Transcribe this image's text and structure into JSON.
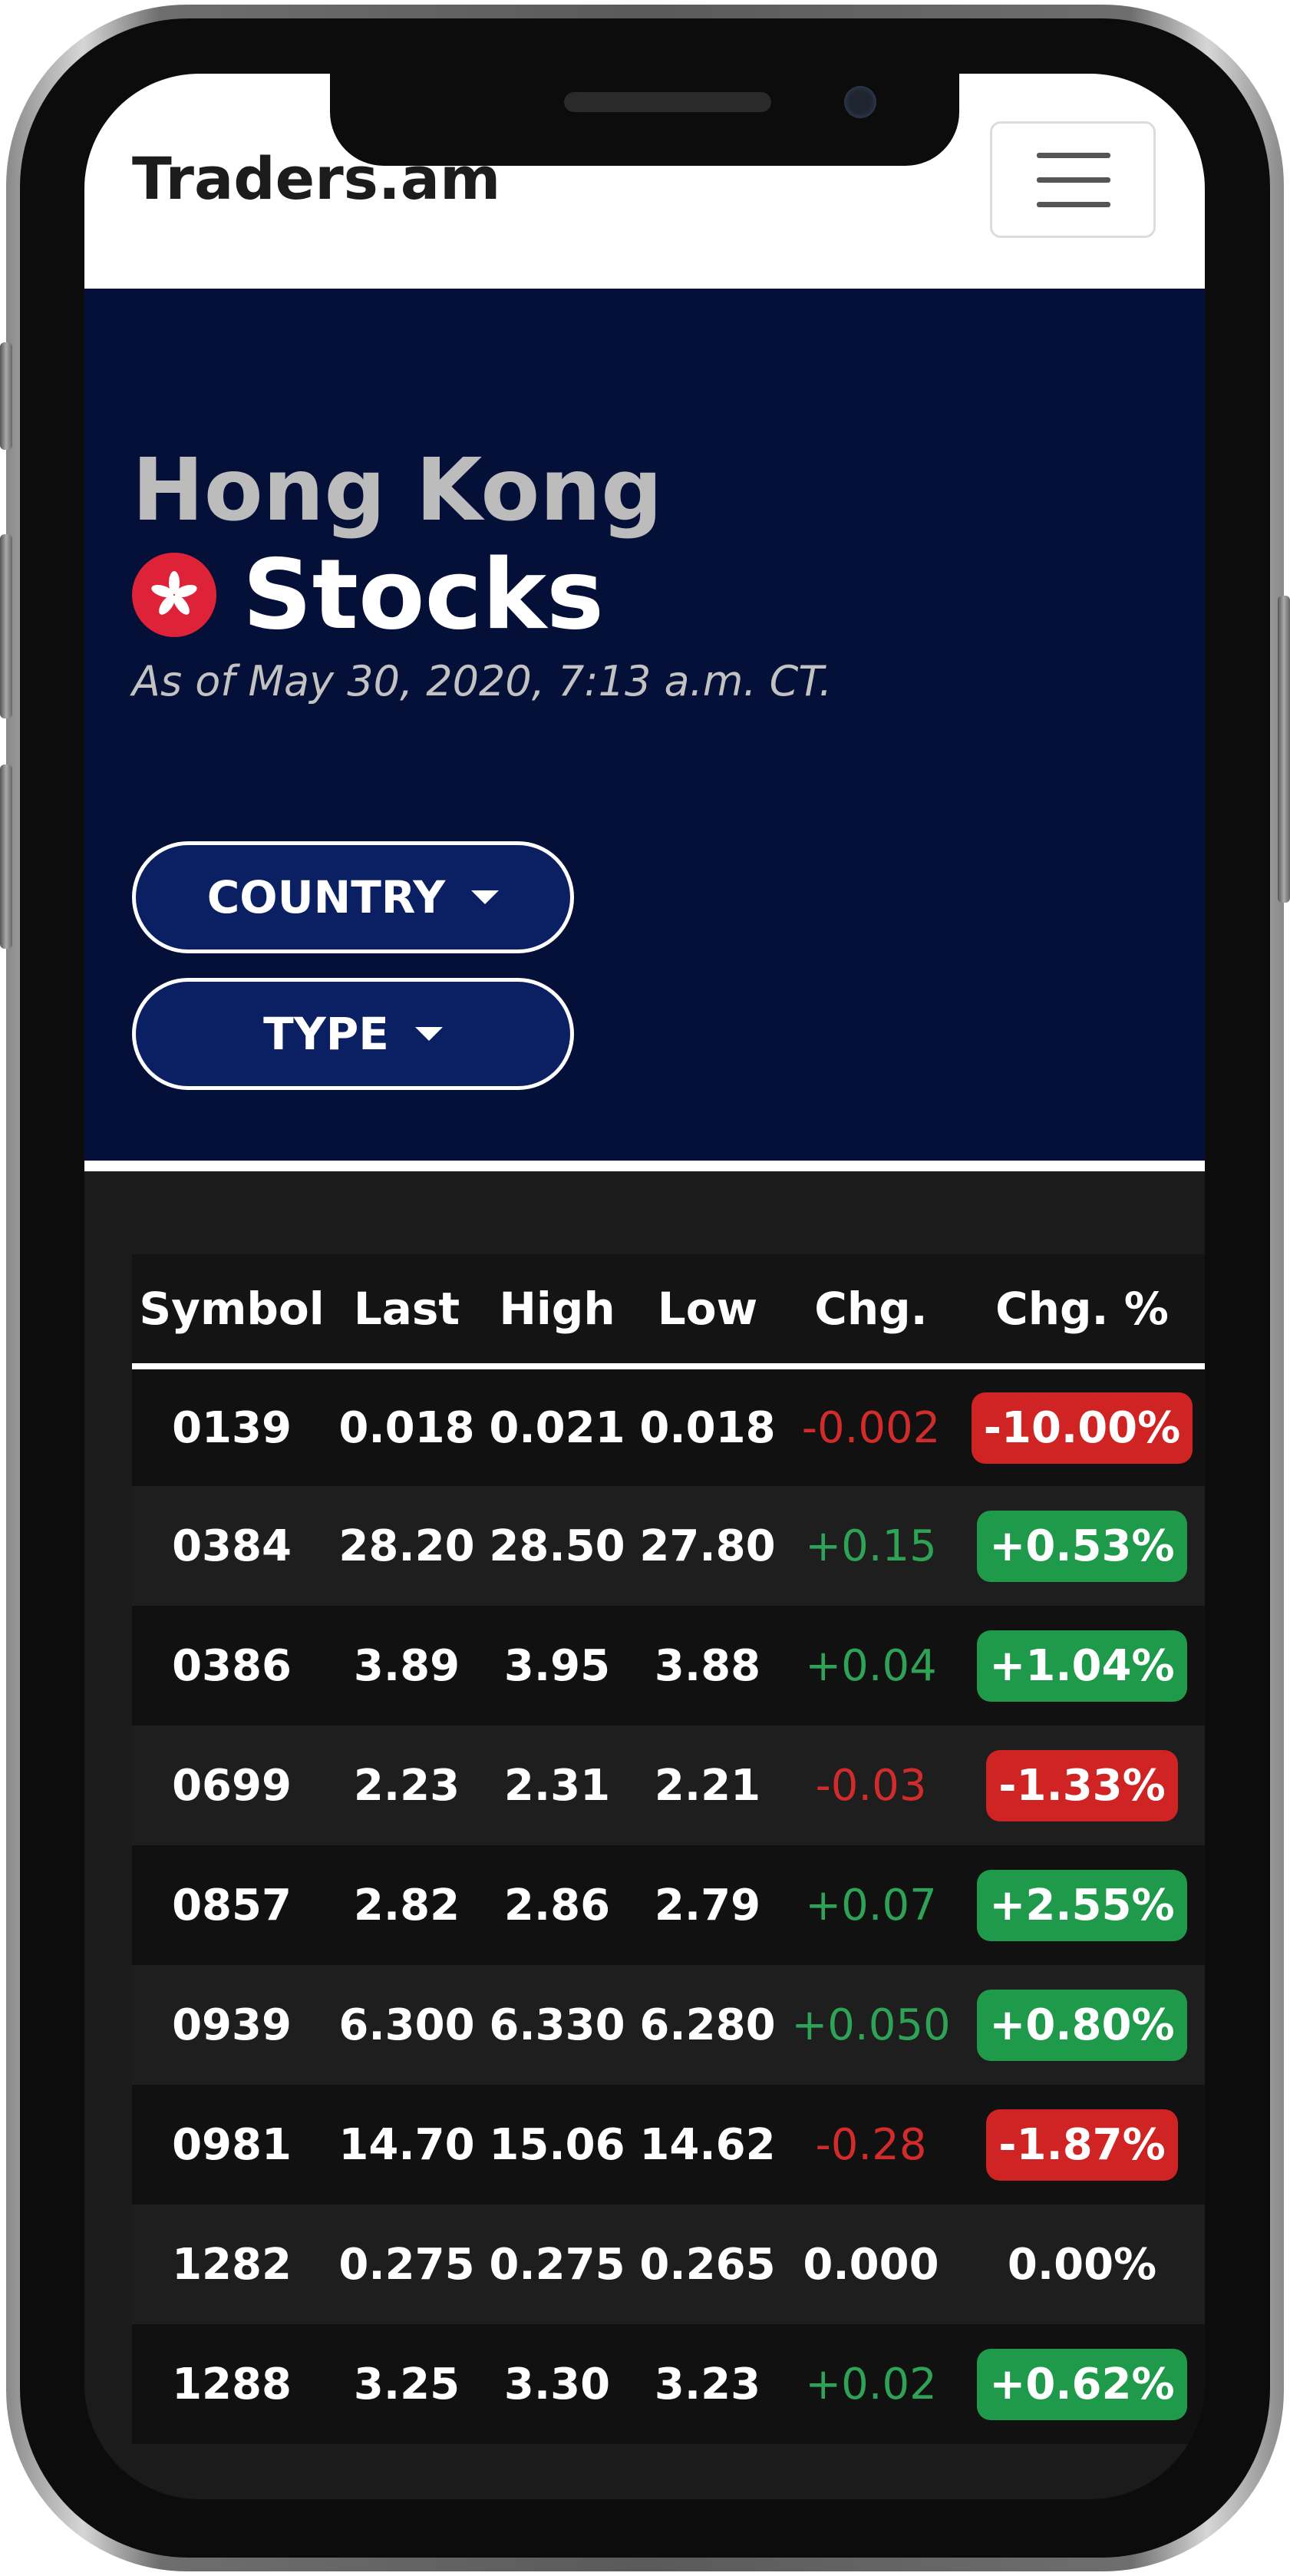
{
  "header": {
    "brand": "Traders.am"
  },
  "hero": {
    "country": "Hong Kong",
    "title": "Stocks",
    "as_of": "As of May 30, 2020, 7:13 a.m. CT.",
    "country_button": "COUNTRY",
    "type_button": "TYPE"
  },
  "colors": {
    "hero_bg": "#051038",
    "pill_bg": "#0b1f63",
    "positive": "#1e9a4a",
    "negative": "#d02323",
    "flag_red": "#de2237"
  },
  "table": {
    "headers": [
      "Symbol",
      "Last",
      "High",
      "Low",
      "Chg.",
      "Chg. %"
    ],
    "rows": [
      {
        "symbol": "0139",
        "last": "0.018",
        "high": "0.021",
        "low": "0.018",
        "chg": "-0.002",
        "chg_pct": "-10.00%",
        "dir": "neg"
      },
      {
        "symbol": "0384",
        "last": "28.20",
        "high": "28.50",
        "low": "27.80",
        "chg": "+0.15",
        "chg_pct": "+0.53%",
        "dir": "pos"
      },
      {
        "symbol": "0386",
        "last": "3.89",
        "high": "3.95",
        "low": "3.88",
        "chg": "+0.04",
        "chg_pct": "+1.04%",
        "dir": "pos"
      },
      {
        "symbol": "0699",
        "last": "2.23",
        "high": "2.31",
        "low": "2.21",
        "chg": "-0.03",
        "chg_pct": "-1.33%",
        "dir": "neg"
      },
      {
        "symbol": "0857",
        "last": "2.82",
        "high": "2.86",
        "low": "2.79",
        "chg": "+0.07",
        "chg_pct": "+2.55%",
        "dir": "pos"
      },
      {
        "symbol": "0939",
        "last": "6.300",
        "high": "6.330",
        "low": "6.280",
        "chg": "+0.050",
        "chg_pct": "+0.80%",
        "dir": "pos"
      },
      {
        "symbol": "0981",
        "last": "14.70",
        "high": "15.06",
        "low": "14.62",
        "chg": "-0.28",
        "chg_pct": "-1.87%",
        "dir": "neg"
      },
      {
        "symbol": "1282",
        "last": "0.275",
        "high": "0.275",
        "low": "0.265",
        "chg": "0.000",
        "chg_pct": "0.00%",
        "dir": "neu"
      },
      {
        "symbol": "1288",
        "last": "3.25",
        "high": "3.30",
        "low": "3.23",
        "chg": "+0.02",
        "chg_pct": "+0.62%",
        "dir": "pos"
      }
    ]
  }
}
